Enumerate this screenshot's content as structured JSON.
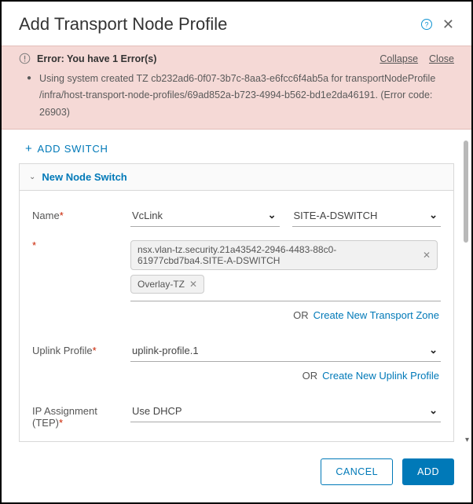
{
  "header": {
    "title": "Add Transport Node Profile"
  },
  "error": {
    "title": "Error: You have 1 Error(s)",
    "collapse_label": "Collapse",
    "close_label": "Close",
    "messages": [
      "Using system created TZ cb232ad6-0f07-3b7c-8aa3-e6fcc6f4ab5a for transportNodeProfile /infra/host-transport-node-profiles/69ad852a-b723-4994-b562-bd1e2da46191. (Error code: 26903)"
    ]
  },
  "add_switch_label": "ADD SWITCH",
  "switch_panel": {
    "title": "New Node Switch",
    "name": {
      "label": "Name",
      "left_value": "VcLink",
      "right_value": "SITE-A-DSWITCH"
    },
    "tz_chips": [
      "nsx.vlan-tz.security.21a43542-2946-4483-88c0-61977cbd7ba4.SITE-A-DSWITCH",
      "Overlay-TZ"
    ],
    "tz_helper": {
      "or": "OR",
      "link": "Create New Transport Zone"
    },
    "uplink_profile": {
      "label": "Uplink Profile",
      "value": "uplink-profile.1"
    },
    "uplink_helper": {
      "or": "OR",
      "link": "Create New Uplink Profile"
    },
    "ip_assignment": {
      "label": "IP Assignment (TEP)",
      "value": "Use DHCP"
    }
  },
  "footer": {
    "cancel_label": "CANCEL",
    "add_label": "ADD"
  }
}
